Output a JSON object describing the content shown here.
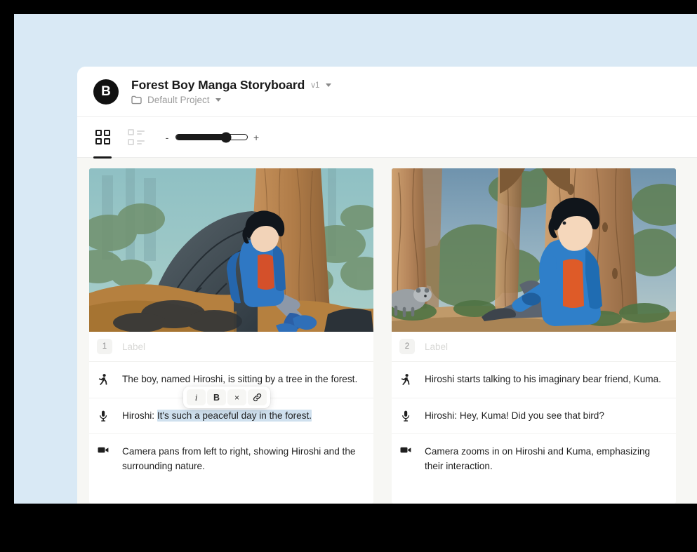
{
  "window": {
    "brand_initial": "B",
    "doc_title": "Forest Boy Manga Storyboard",
    "version_label": "v1",
    "project_name": "Default Project"
  },
  "toolbar": {
    "grid_view_icon": "grid-view-icon",
    "list_view_icon": "list-view-icon",
    "zoom_minus": "-",
    "zoom_plus": "+",
    "zoom_percent": 70
  },
  "format_toolbar": {
    "italic_label": "i",
    "bold_label": "B",
    "clear_label": "×",
    "link_label": "link-icon"
  },
  "colors": {
    "frame_border": "#000000",
    "canvas_blue": "#d9e9f5",
    "board_bg": "#f7f7f4",
    "card_bg": "#ffffff",
    "accent_dark": "#1a1a1a",
    "selection_highlight": "#cfe0ee",
    "muted_text": "#9b9b9b",
    "placeholder_text": "#d8d8d6"
  },
  "scenes": [
    {
      "number": "1",
      "label_placeholder": "Label",
      "image_alt": "Manga boy in blue hoodie sitting against a large gnarled tree root in a teal forest",
      "rows": [
        {
          "icon": "action-running-icon",
          "type": "action",
          "text": "The boy, named Hiroshi, is sitting by a tree in the forest.",
          "has_format_toolbar": true
        },
        {
          "icon": "microphone-icon",
          "type": "dialogue",
          "prefix": "Hiroshi: ",
          "highlighted": "It's such a peaceful day in the forest.",
          "text": "Hiroshi: It's such a peaceful day in the forest."
        },
        {
          "icon": "video-camera-icon",
          "type": "camera",
          "text": "Camera pans from left to right, showing Hiroshi and the surrounding nature."
        }
      ]
    },
    {
      "number": "2",
      "label_placeholder": "Label",
      "image_alt": "Manga boy in blue jacket seated by a tall tree trunk with a bear approaching from the left",
      "rows": [
        {
          "icon": "action-running-icon",
          "type": "action",
          "text": "Hiroshi starts talking to his imaginary bear friend, Kuma."
        },
        {
          "icon": "microphone-icon",
          "type": "dialogue",
          "text": "Hiroshi: Hey, Kuma! Did you see that bird?"
        },
        {
          "icon": "video-camera-icon",
          "type": "camera",
          "text": "Camera zooms in on Hiroshi and Kuma, emphasizing their interaction."
        }
      ]
    }
  ]
}
